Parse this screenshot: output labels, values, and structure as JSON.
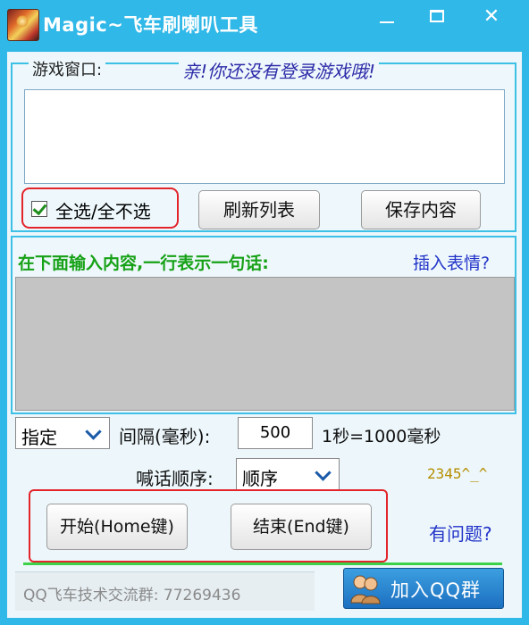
{
  "window": {
    "title": "Magic~飞车刷喇叭工具",
    "minimize": "",
    "maximize": "",
    "close": "✕"
  },
  "game_window": {
    "label": "游戏窗口:",
    "notice": "亲!你还没有登录游戏哦!",
    "select_all_label": "全选/全不选",
    "select_all_checked": true,
    "refresh_button": "刷新列表",
    "save_button": "保存内容"
  },
  "content": {
    "hint": "在下面输入内容,一行表示一句话:",
    "insert_emoji_link": "插入表情?",
    "text": ""
  },
  "settings": {
    "mode_value": "指定",
    "interval_label": "间隔(毫秒):",
    "interval_value": "500",
    "interval_note": "1秒=1000毫秒",
    "order_label": "喊话顺序:",
    "order_value": "顺序",
    "side_text": "2345^_^"
  },
  "actions": {
    "start_button": "开始(Home键)",
    "stop_button": "结束(End键)",
    "help_link": "有问题?"
  },
  "footer": {
    "qq_group_text": "QQ飞车技术交流群: 77269436",
    "join_qq_button": "加入QQ群"
  },
  "colors": {
    "titlebar": "#30b8e8",
    "group_border": "#3cc0e6",
    "highlight_red": "#e3242b",
    "hint_green": "#17a117",
    "link_blue": "#2233c8"
  }
}
